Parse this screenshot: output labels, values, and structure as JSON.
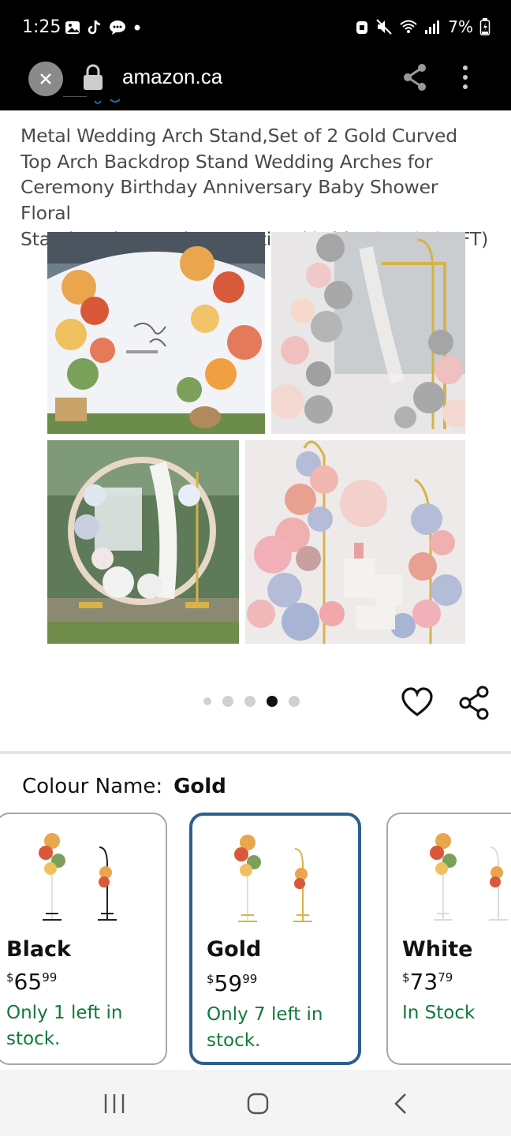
{
  "status_bar": {
    "time": "1:25",
    "battery": "7%"
  },
  "browser": {
    "url": "amazon.ca"
  },
  "product": {
    "title_lines": [
      "Metal Wedding Arch Stand,Set of 2 Gold Curved",
      "Top Arch Backdrop Stand Wedding Arches for",
      "Ceremony Birthday Anniversary Baby Shower Floral",
      "Stand Background Decoration (Gold,7.8FT & 6.7FT)"
    ],
    "image_count": 5,
    "active_image_index": 3
  },
  "colour": {
    "label": "Colour Name:",
    "selected": "Gold"
  },
  "swatches": [
    {
      "name": "Black",
      "currency": "$",
      "price_whole": "65",
      "price_fraction": "99",
      "stock_lines": [
        "Only 1 left in",
        "stock."
      ],
      "selected": false
    },
    {
      "name": "Gold",
      "currency": "$",
      "price_whole": "59",
      "price_fraction": "99",
      "stock_lines": [
        "Only 7 left in",
        "stock."
      ],
      "selected": true
    },
    {
      "name": "White",
      "currency": "$",
      "price_whole": "73",
      "price_fraction": "79",
      "stock_lines": [
        "In Stock"
      ],
      "selected": false
    }
  ],
  "colors": {
    "selected_border": "#2d5f8f",
    "stock_green": "#0f7a3a",
    "title_gray": "#4a4a4a"
  }
}
